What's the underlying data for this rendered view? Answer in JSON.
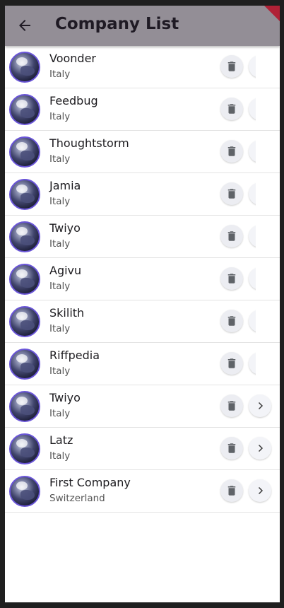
{
  "appbar": {
    "title": "Company List",
    "back_icon": "arrow-back-icon",
    "color": "#938e96"
  },
  "companies": [
    {
      "name": "Voonder",
      "country": "Italy"
    },
    {
      "name": "Feedbug",
      "country": "Italy"
    },
    {
      "name": "Thoughtstorm",
      "country": "Italy"
    },
    {
      "name": "Jamia",
      "country": "Italy"
    },
    {
      "name": "Twiyo",
      "country": "Italy"
    },
    {
      "name": "Agivu",
      "country": "Italy"
    },
    {
      "name": "Skilith",
      "country": "Italy"
    },
    {
      "name": "Riffpedia",
      "country": "Italy"
    },
    {
      "name": "Twiyo",
      "country": "Italy"
    },
    {
      "name": "Latz",
      "country": "Italy"
    },
    {
      "name": "First Company",
      "country": "Switzerland"
    }
  ],
  "row_actions": {
    "delete_icon": "trash-icon",
    "open_icon": "chevron-right-icon"
  },
  "colors": {
    "avatar_border": "#6a55d8",
    "debug_banner": "#b02136"
  }
}
